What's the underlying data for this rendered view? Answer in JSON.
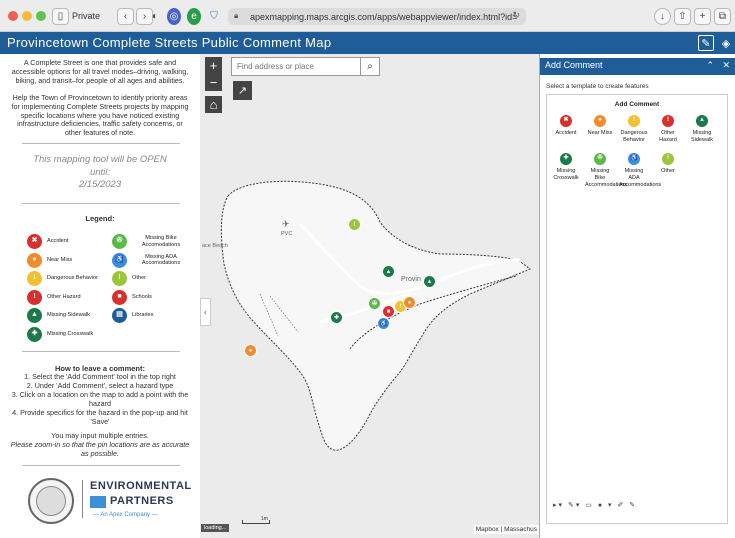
{
  "browser": {
    "tab_label": "Private",
    "url": "apexmapping.maps.arcgis.com/apps/webappviewer/index.html?id=",
    "back_icon": "chevron-left-icon",
    "forward_icon": "chevron-right-icon"
  },
  "app": {
    "title": "Provincetown Complete Streets Public Comment Map"
  },
  "intro": {
    "p1": "A Complete Street is one that provides safe and accessible options for all travel modes–driving, walking, biking, and transit–for people of all ages and abilities.",
    "p2": "Help the Town of Provincetown to identify priority areas for implementing Complete Streets projects by mapping specific locations where you have noticed existing infrastructure deficiencies, traffic safety concerns, or other features of note.",
    "open_line1": "This mapping tool will be OPEN",
    "open_line2": "until:",
    "open_date": "2/15/2023"
  },
  "legend": {
    "title": "Legend:",
    "left": [
      {
        "label": "Accident",
        "color": "#d7302e",
        "glyph": "✖"
      },
      {
        "label": "Near Miss",
        "color": "#f08c2e",
        "glyph": "●"
      },
      {
        "label": "Dangerous Behavior",
        "color": "#f2c12e",
        "glyph": "!"
      },
      {
        "label": "Other Hazard",
        "color": "#d7302e",
        "glyph": "!"
      },
      {
        "label": "Missing Sidewalk",
        "color": "#1c7a4a",
        "glyph": "▲"
      },
      {
        "label": "Missing Crosswalk",
        "color": "#1c7a4a",
        "glyph": "✚"
      }
    ],
    "right": [
      {
        "label": "Missing Bike Accomodations",
        "color": "#5db848",
        "glyph": "✇"
      },
      {
        "label": "Missing ADA Accomodations",
        "color": "#3b8fd4",
        "glyph": "♿"
      },
      {
        "label": "Other",
        "color": "#9bc53d",
        "glyph": "!"
      },
      {
        "label": "Schools",
        "color": "#d7302e",
        "glyph": "■"
      },
      {
        "label": "Libraries",
        "color": "#1f5d99",
        "glyph": "▤"
      }
    ]
  },
  "howto": {
    "title": "How to leave a comment:",
    "steps": [
      "1. Select the 'Add Comment' tool in the top right",
      "2. Under 'Add Comment', select a hazard type",
      "3. Click on a location on the map to add a point with the hazard",
      "4. Provide specifics for the hazard in the pop-up and hit 'Save'"
    ],
    "note1": "You may input multiple entries.",
    "note2": "Please zoom-in so that the pin locations are as accurate as possible."
  },
  "logo": {
    "brand1": "ENVIRONMENTAL",
    "brand2": "PARTNERS",
    "tagline": "— An Apex Company —",
    "seal_text": "TOWN OF PROVINCETOWN"
  },
  "map": {
    "search_placeholder": "Find address or place",
    "zoom_in": "+",
    "zoom_out": "−",
    "loading": "loading...",
    "attribution": "Mapbox | Massachus",
    "label_town": "Provin",
    "label_pvc": "PVC",
    "label_beach": "ace Beach",
    "scale": "1m"
  },
  "panel": {
    "title": "Add Comment",
    "instruction": "Select a template to create features",
    "group": "Add Comment",
    "templates": [
      {
        "label": "Accident",
        "color": "#d7302e",
        "glyph": "✖"
      },
      {
        "label": "Near Miss",
        "color": "#f08c2e",
        "glyph": "●"
      },
      {
        "label": "Dangerous Behavior",
        "color": "#f2c12e",
        "glyph": "!"
      },
      {
        "label": "Other Hazard",
        "color": "#d7302e",
        "glyph": "!"
      },
      {
        "label": "Missing Sidewalk",
        "color": "#1c7a4a",
        "glyph": "▲"
      },
      {
        "label": "Missing Crosswalk",
        "color": "#1c7a4a",
        "glyph": "✚"
      },
      {
        "label": "Missing Bike Accommodations",
        "color": "#5db848",
        "glyph": "✇"
      },
      {
        "label": "Missing ADA Accommodations",
        "color": "#3b8fd4",
        "glyph": "♿"
      },
      {
        "label": "Other",
        "color": "#9bc53d",
        "glyph": "!"
      }
    ]
  }
}
